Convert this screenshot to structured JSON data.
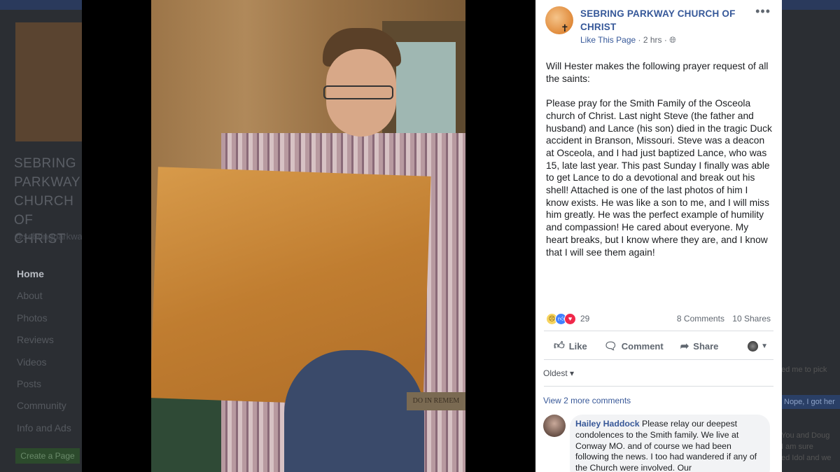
{
  "background_page": {
    "page_name": "SEBRING PARKWAY CHURCH OF CHRIST",
    "handle": "@sebringparkwaychurchofchrist",
    "nav": [
      "Home",
      "About",
      "Photos",
      "Reviews",
      "Videos",
      "Posts",
      "Community",
      "Info and Ads"
    ],
    "create_page": "Create a Page",
    "right_snippets": [
      "ed me to pick",
      "Nope, I got her",
      "You and Doug",
      "I am sure",
      "ed Idol and we"
    ]
  },
  "photo": {
    "plaque_text": "DO IN REMEM"
  },
  "post": {
    "page_name": "SEBRING PARKWAY CHURCH OF CHRIST",
    "like_page": "Like This Page",
    "time": "2 hrs",
    "more": "•••",
    "paragraph1": "Will Hester makes the following prayer request of all the saints:",
    "paragraph2": "Please pray for the Smith Family of the Osceola church of Christ. Last night Steve (the father and husband) and Lance (his son) died in the tragic Duck accident in Branson, Missouri. Steve was a deacon at Osceola, and I had just baptized Lance, who was 15, late last year. This past Sunday I finally was able to get Lance to do a devotional and break out his shell! Attached is one of the last photos of him I know exists. He was like a son to me, and I will miss him greatly. He was the perfect example of humility and compassion! He cared about everyone. My heart breaks, but I know where they are, and I know that I will see them again!",
    "reaction_count": "29",
    "comments_count": "8 Comments",
    "shares_count": "10 Shares",
    "actions": {
      "like": "Like",
      "comment": "Comment",
      "share": "Share"
    },
    "sort_label": "Oldest ▾",
    "view_more": "View 2 more comments",
    "comment": {
      "author": "Hailey Haddock",
      "text": "Please relay our deepest condolences to the Smith family. We live at Conway MO. and of course we had been following the news. I too had wandered if any of the Church were involved. Our"
    }
  },
  "colors": {
    "link_blue": "#365899",
    "page_bg": "#1d2129",
    "panel_bg": "#ffffff"
  }
}
